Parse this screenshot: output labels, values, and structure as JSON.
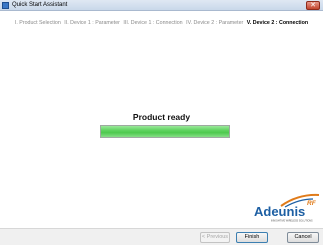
{
  "window": {
    "title": "Quick Start Assistant",
    "close_glyph": "✕"
  },
  "steps": [
    {
      "label": "I. Product Selection",
      "current": false
    },
    {
      "label": "II. Device 1 : Parameter",
      "current": false
    },
    {
      "label": "III. Device 1 : Connection",
      "current": false
    },
    {
      "label": "IV. Device 2 : Parameter",
      "current": false
    },
    {
      "label": "V. Device 2 : Connection",
      "current": true
    }
  ],
  "status": {
    "title": "Product ready",
    "progress_fraction": 1.0
  },
  "logo": {
    "text": "Adeunis",
    "superscript": "RF",
    "tagline": "INNOVATIVE WIRELESS SOLUTIONS"
  },
  "buttons": {
    "previous": "< Previous",
    "finish": "Finish",
    "cancel": "Cancel"
  },
  "colors": {
    "progress": "#4ec94e",
    "brand_blue": "#1d5fa3",
    "brand_orange": "#e07b1a"
  }
}
